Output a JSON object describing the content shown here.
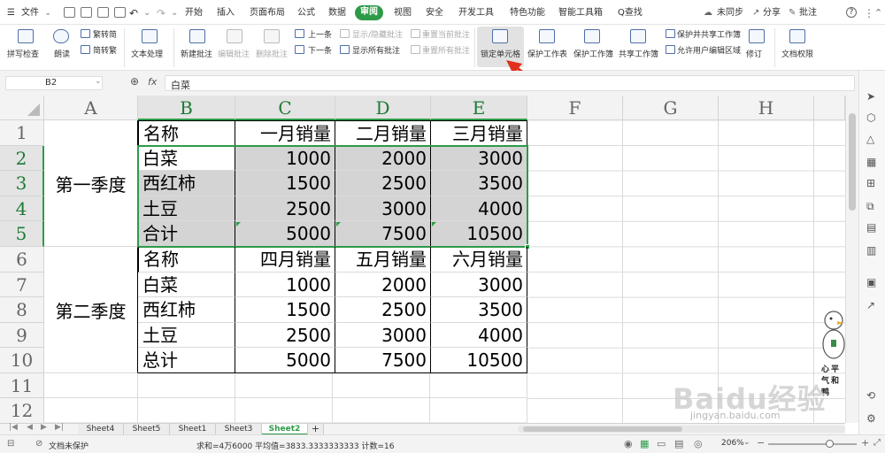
{
  "menu": {
    "file": "文件",
    "tabs": [
      "开始",
      "插入",
      "页面布局",
      "公式",
      "数据",
      "审阅",
      "视图",
      "安全",
      "开发工具",
      "特色功能",
      "智能工具箱"
    ],
    "active_tab": "审阅",
    "search": "Q查找",
    "sync": "未同步",
    "share": "分享",
    "comment": "批注",
    "help": "?"
  },
  "ribbon": {
    "spell_check": "拼写检查",
    "read_aloud": "朗读",
    "trad_to_simp": "繁转简",
    "simp_to_trad": "简转繁",
    "text_process": "文本处理",
    "new_comment": "新建批注",
    "edit_comment": "编辑批注",
    "delete_comment": "删除批注",
    "prev": "上一条",
    "next": "下一条",
    "show_hide_comment": "显示/隐藏批注",
    "show_all_comments": "显示所有批注",
    "reset_current_comment": "重置当前批注",
    "reset_all_comments": "重置所有批注",
    "lock_cell": "锁定单元格",
    "protect_sheet": "保护工作表",
    "protect_workbook": "保护工作簿",
    "share_workbook": "共享工作簿",
    "protect_share_workbook": "保护并共享工作簿",
    "allow_edit_ranges": "允许用户编辑区域",
    "revise": "修订",
    "doc_permission": "文档权限"
  },
  "formula_bar": {
    "cell_ref": "B2",
    "fx": "fx",
    "content": "白菜"
  },
  "grid": {
    "columns": [
      "A",
      "B",
      "C",
      "D",
      "E",
      "F",
      "G",
      "H"
    ],
    "rows": [
      "1",
      "2",
      "3",
      "4",
      "5",
      "6",
      "7",
      "8",
      "9",
      "10",
      "11",
      "12"
    ],
    "group1": "第一季度",
    "group2": "第二季度",
    "table1": {
      "header": [
        "名称",
        "一月销量",
        "二月销量",
        "三月销量"
      ],
      "rows": [
        [
          "白菜",
          "1000",
          "2000",
          "3000"
        ],
        [
          "西红柿",
          "1500",
          "2500",
          "3500"
        ],
        [
          "土豆",
          "2500",
          "3000",
          "4000"
        ],
        [
          "合计",
          "5000",
          "7500",
          "10500"
        ]
      ]
    },
    "table2": {
      "header": [
        "名称",
        "四月销量",
        "五月销量",
        "六月销量"
      ],
      "rows": [
        [
          "白菜",
          "1000",
          "2000",
          "3000"
        ],
        [
          "西红柿",
          "1500",
          "2500",
          "3500"
        ],
        [
          "土豆",
          "2500",
          "3000",
          "4000"
        ],
        [
          "总计",
          "5000",
          "7500",
          "10500"
        ]
      ]
    }
  },
  "sheet_tabs": [
    "Sheet4",
    "Sheet5",
    "Sheet1",
    "Sheet3",
    "Sheet2"
  ],
  "active_sheet": "Sheet2",
  "add_sheet": "+",
  "status": {
    "protect": "文档未保护",
    "stats": "求和=4万6000  平均值=3833.3333333333  计数=16",
    "zoom": "206%"
  },
  "watermark": {
    "handwriting": "心平气和鸭",
    "brand": "Baidu经验",
    "url": "jingyan.baidu.com"
  },
  "colors": {
    "accent": "#2e9a48",
    "active_tab_bg": "#2e9a48",
    "arrow": "#e0301e",
    "selection_shade": "#d4d4d4"
  }
}
